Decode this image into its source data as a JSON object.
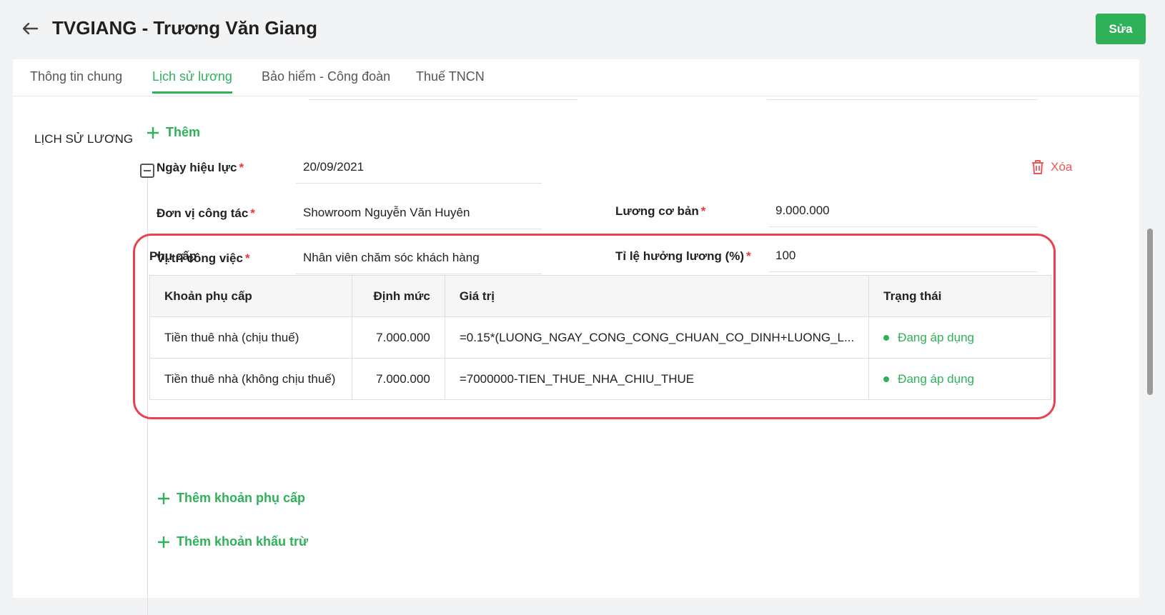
{
  "header": {
    "title": "TVGIANG - Trương Văn Giang",
    "edit_label": "Sửa"
  },
  "tabs": [
    {
      "label": "Thông tin chung",
      "active": false
    },
    {
      "label": "Lịch sử lương",
      "active": true
    },
    {
      "label": "Bảo hiểm - Công đoàn",
      "active": false
    },
    {
      "label": "Thuế TNCN",
      "active": false
    }
  ],
  "salary_history": {
    "section_title": "LỊCH SỬ LƯƠNG",
    "add_label": "Thêm",
    "delete_label": "Xóa",
    "fields": {
      "effective_date": {
        "label": "Ngày hiệu lực",
        "value": "20/09/2021"
      },
      "work_unit": {
        "label": "Đơn vị công tác",
        "value": "Showroom Nguyễn Văn Huyên"
      },
      "position": {
        "label": "Vị trí công việc",
        "value": "Nhân viên chăm sóc khách hàng"
      },
      "base_salary": {
        "label": "Lương cơ bản",
        "value": "9.000.000"
      },
      "salary_ratio": {
        "label": "Tỉ lệ hưởng lương (%)",
        "value": "100"
      }
    },
    "required_mark": "*"
  },
  "allowance": {
    "title": "Phụ cấp",
    "columns": [
      "Khoản phụ cấp",
      "Định mức",
      "Giá trị",
      "Trạng thái"
    ],
    "rows": [
      {
        "name": "Tiền thuê nhà (chịu thuế)",
        "amount": "7.000.000",
        "formula": "=0.15*(LUONG_NGAY_CONG_CONG_CHUAN_CO_DINH+LUONG_L...",
        "status": "Đang áp dụng"
      },
      {
        "name": "Tiền thuê nhà (không chịu thuế)",
        "amount": "7.000.000",
        "formula": "=7000000-TIEN_THUE_NHA_CHIU_THUE",
        "status": "Đang áp dụng"
      }
    ],
    "add_allowance_label": "Thêm khoản phụ cấp",
    "add_deduction_label": "Thêm khoản khấu trừ"
  },
  "colors": {
    "accent": "#2fb15a",
    "danger": "#e8585b",
    "highlight": "#e84150"
  }
}
